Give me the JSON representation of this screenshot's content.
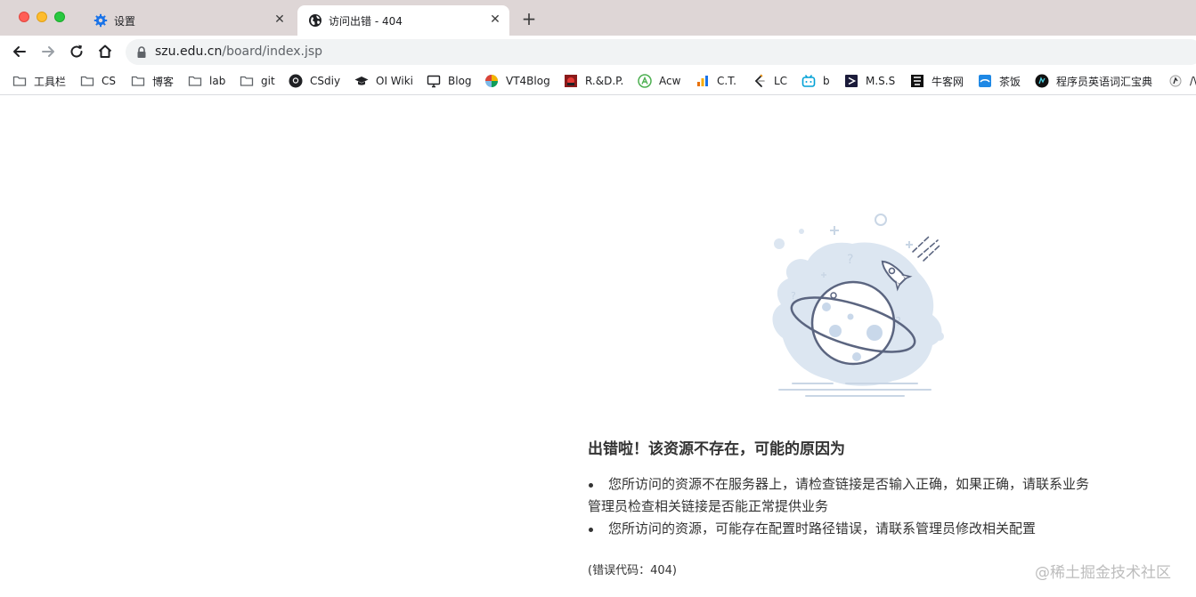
{
  "browser": {
    "tabs": [
      {
        "title": "设置",
        "icon": "gear-icon",
        "active": false
      },
      {
        "title": "访问出错 - 404",
        "icon": "globe-icon",
        "active": true
      }
    ],
    "close_glyph": "✕",
    "new_tab_glyph": "+",
    "url": {
      "host": "szu.edu.cn",
      "path": "/board/index.jsp"
    }
  },
  "bookmarks": [
    {
      "label": "工具栏",
      "icon": "folder-icon"
    },
    {
      "label": "CS",
      "icon": "folder-icon"
    },
    {
      "label": "博客",
      "icon": "folder-icon"
    },
    {
      "label": "lab",
      "icon": "folder-icon"
    },
    {
      "label": "git",
      "icon": "folder-icon"
    },
    {
      "label": "CSdiy",
      "icon": "github-icon"
    },
    {
      "label": "OI Wiki",
      "icon": "graduation-cap-icon"
    },
    {
      "label": "Blog",
      "icon": "monitor-icon"
    },
    {
      "label": "VT4Blog",
      "icon": "colorful-ball-icon"
    },
    {
      "label": "R.&D.P.",
      "icon": "red-square-icon"
    },
    {
      "label": "Acw",
      "icon": "acw-icon"
    },
    {
      "label": "C.T.",
      "icon": "bar-chart-icon"
    },
    {
      "label": "LC",
      "icon": "leetcode-icon"
    },
    {
      "label": "b",
      "icon": "bilibili-icon"
    },
    {
      "label": "M.S.S",
      "icon": "play-square-icon"
    },
    {
      "label": "牛客网",
      "icon": "nowcoder-icon"
    },
    {
      "label": "茶饭",
      "icon": "blue-square-icon"
    },
    {
      "label": "程序员英语词汇宝典",
      "icon": "dark-circle-icon"
    },
    {
      "label": "/\\",
      "icon": "partial-icon"
    }
  ],
  "page": {
    "title": "出错啦！该资源不存在，可能的原因为",
    "reasons": [
      {
        "line1": "您所访问的资源不在服务器上，请检查链接是否输入正确，如果正确，请联系业务",
        "line2": "管理员检查相关链接是否能正常提供业务"
      },
      {
        "line1": "您所访问的资源，可能存在配置时路径错误，请联系管理员修改相关配置",
        "line2": ""
      }
    ],
    "error_code": "(错误代码：404)",
    "watermark": "@稀土掘金技术社区"
  },
  "colors": {
    "tab_strip": "#ded6d6",
    "omnibox": "#f1f3f4",
    "illustration_blue": "#dce6f1",
    "illustration_stroke": "#5b6580"
  }
}
